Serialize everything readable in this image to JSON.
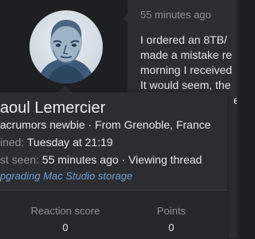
{
  "post": {
    "time": "55 minutes ago",
    "lines": [
      "I ordered an 8TB/",
      "made a mistake re",
      "morning I received",
      "It would seem, the",
      "e"
    ]
  },
  "profile": {
    "username": "aoul Lemercier",
    "title_line": "acrumors newbie · From Grenoble, France",
    "joined_label": "ined:",
    "joined_value": "Tuesday at 21:19",
    "last_seen_label": "st seen:",
    "last_seen_value": "55 minutes ago · Viewing thread",
    "activity": "pgrading Mac Studio storage",
    "stats": {
      "reaction_label": "Reaction score",
      "reaction_value": "0",
      "points_label": "Points",
      "points_value": "0"
    }
  },
  "colors": {
    "background": "#1d1f21",
    "panel": "#2b2d30",
    "link": "#6c9fd6",
    "muted": "#8e9297"
  }
}
